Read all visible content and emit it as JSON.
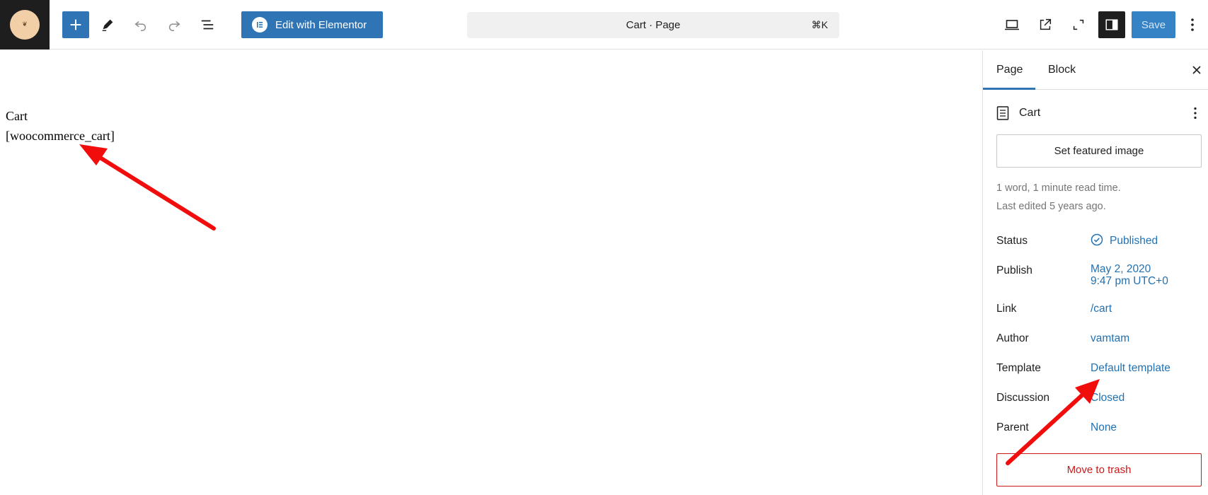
{
  "toolbar": {
    "edit_with_elementor_label": "Edit with Elementor",
    "command_bar_title": "Cart · Page",
    "command_bar_shortcut": "⌘K",
    "save_label": "Save"
  },
  "canvas": {
    "page_title": "Cart",
    "shortcode": "[woocommerce_cart]"
  },
  "sidebar": {
    "tabs": [
      {
        "label": "Page"
      },
      {
        "label": "Block"
      }
    ],
    "document_title": "Cart",
    "featured_image_button": "Set featured image",
    "meta_words": "1 word, 1 minute read time.",
    "meta_last_edited": "Last edited 5 years ago.",
    "properties": {
      "status_label": "Status",
      "status_value": "Published",
      "publish_label": "Publish",
      "publish_date": "May 2, 2020",
      "publish_time": "9:47 pm UTC+0",
      "link_label": "Link",
      "link_value": "/cart",
      "author_label": "Author",
      "author_value": "vamtam",
      "template_label": "Template",
      "template_value": "Default template",
      "discussion_label": "Discussion",
      "discussion_value": "Closed",
      "parent_label": "Parent",
      "parent_value": "None"
    },
    "trash_button": "Move to trash"
  },
  "colors": {
    "accent_blue": "#2f74b5",
    "link_blue": "#2271b1",
    "danger_red": "#cc1818",
    "annotation_red": "#f20d0d"
  },
  "icons": {
    "site_logo": "site-logo-icon",
    "add": "plus-icon",
    "tools": "pencil-icon",
    "undo": "undo-icon",
    "redo": "redo-icon",
    "document_overview": "list-view-icon",
    "elementor": "elementor-icon",
    "view": "desktop-view-icon",
    "preview": "external-link-icon",
    "fullscreen": "fullscreen-icon",
    "settings": "sidebar-settings-icon",
    "options": "more-vertical-icon",
    "close": "close-icon",
    "page_doc": "page-document-icon",
    "status": "check-circle-icon"
  }
}
